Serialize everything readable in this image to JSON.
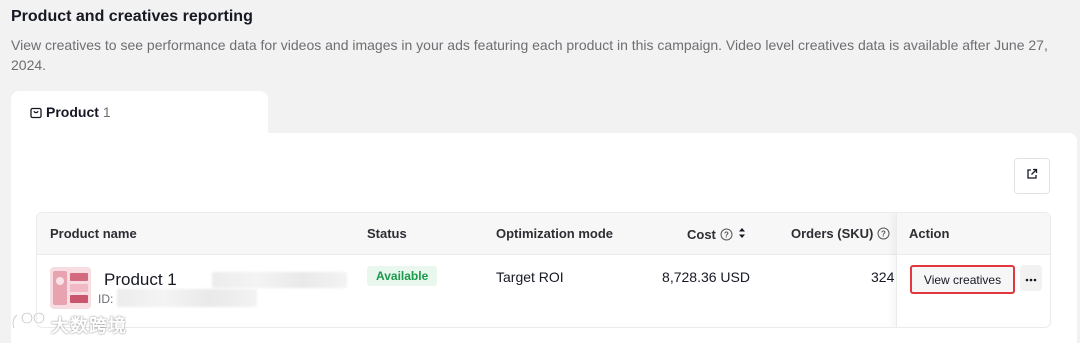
{
  "header": {
    "title": "Product and creatives reporting",
    "description": "View creatives to see performance data for videos and images in your ads featuring each product in this campaign. Video level creatives data is available after June 27, 2024."
  },
  "tabs": [
    {
      "label": "Product",
      "count": "1",
      "icon": "product-tag-icon"
    }
  ],
  "toolbar": {
    "export_icon": "export-icon"
  },
  "table": {
    "columns": {
      "product_name": "Product name",
      "status": "Status",
      "optimization_mode": "Optimization mode",
      "cost": "Cost",
      "orders": "Orders (SKU)",
      "action": "Action"
    },
    "rows": [
      {
        "product_name": "Product 1",
        "id_label": "ID:",
        "status": "Available",
        "optimization_mode": "Target ROI",
        "cost": "8,728.36 USD",
        "orders": "324",
        "action_label": "View creatives",
        "more_label": "···"
      }
    ]
  },
  "watermark": {
    "text": "大数跨境"
  },
  "colors": {
    "status_available_bg": "#e9f7ee",
    "status_available_text": "#1a9a4b",
    "highlight_border": "#e0383e"
  }
}
